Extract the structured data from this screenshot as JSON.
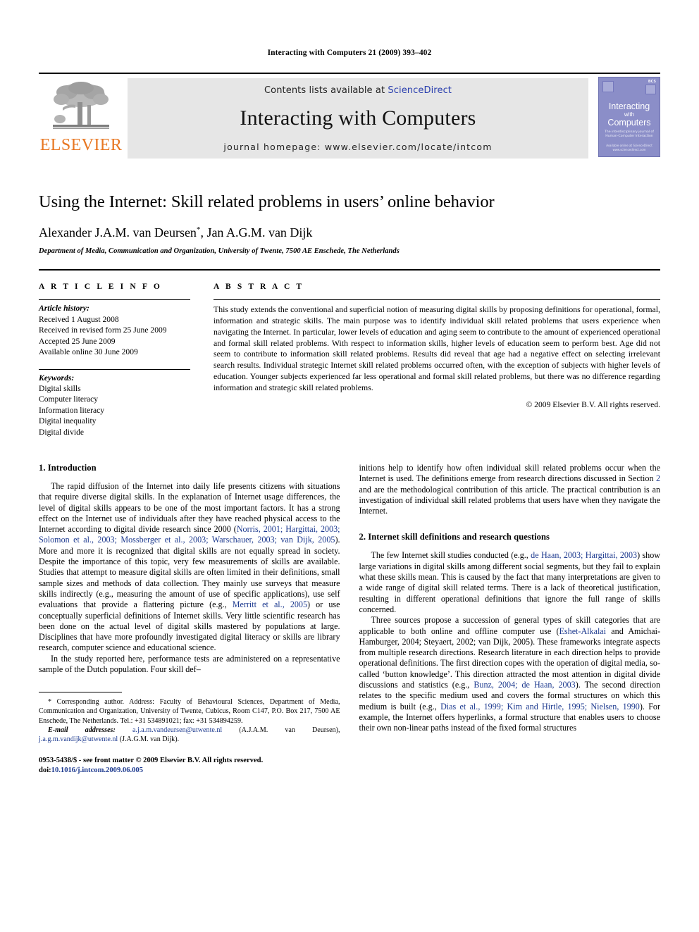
{
  "running_head": "Interacting with Computers 21 (2009) 393–402",
  "masthead": {
    "publisher_name": "ELSEVIER",
    "contents_prefix": "Contents lists available at ",
    "contents_link": "ScienceDirect",
    "journal_title": "Interacting with Computers",
    "homepage_line": "journal homepage: www.elsevier.com/locate/intcom",
    "cover": {
      "title_line1": "Interacting",
      "title_line2": "with",
      "title_line3": "Computers",
      "subtitle": "The interdisciplinary journal of Human-Computer Interaction",
      "badge": "BCS",
      "footer": "Available online at ScienceDirect www.sciencedirect.com"
    },
    "colors": {
      "elsevier_orange": "#E87722",
      "banner_gray": "#e6e6e6",
      "cover_purple": "#8b8ec8",
      "link_blue": "#2a3fae"
    }
  },
  "title": "Using the Internet: Skill related problems in users’ online behavior",
  "authors": "Alexander J.A.M. van Deursen",
  "authors_marker": "*",
  "authors_rest": ", Jan A.G.M. van Dijk",
  "affiliation": "Department of Media, Communication and Organization, University of Twente, 7500 AE Enschede, The Netherlands",
  "article_info": {
    "heading": "A R T I C L E   I N F O",
    "history_label": "Article history:",
    "history": [
      "Received 1 August 2008",
      "Received in revised form 25 June 2009",
      "Accepted 25 June 2009",
      "Available online 30 June 2009"
    ],
    "keywords_label": "Keywords:",
    "keywords": [
      "Digital skills",
      "Computer literacy",
      "Information literacy",
      "Digital inequality",
      "Digital divide"
    ]
  },
  "abstract": {
    "heading": "A B S T R A C T",
    "text": "This study extends the conventional and superficial notion of measuring digital skills by proposing definitions for operational, formal, information and strategic skills. The main purpose was to identify individual skill related problems that users experience when navigating the Internet. In particular, lower levels of education and aging seem to contribute to the amount of experienced operational and formal skill related problems. With respect to information skills, higher levels of education seem to perform best. Age did not seem to contribute to information skill related problems. Results did reveal that age had a negative effect on selecting irrelevant search results. Individual strategic Internet skill related problems occurred often, with the exception of subjects with higher levels of education. Younger subjects experienced far less operational and formal skill related problems, but there was no difference regarding information and strategic skill related problems.",
    "copyright": "© 2009 Elsevier B.V. All rights reserved."
  },
  "sections": {
    "intro_heading": "1. Introduction",
    "intro_p1_a": "The rapid diffusion of the Internet into daily life presents citizens with situations that require diverse digital skills. In the explanation of Internet usage differences, the level of digital skills appears to be one of the most important factors. It has a strong effect on the Internet use of individuals after they have reached physical access to the Internet according to digital divide research since 2000 (",
    "intro_p1_cite1": "Norris, 2001; Hargittai, 2003; Solomon et al., 2003; Mossberger et al., 2003; Warschauer, 2003; van Dijk, 2005",
    "intro_p1_b": "). More and more it is recognized that digital skills are not equally spread in society. Despite the importance of this topic, very few measurements of skills are available. Studies that attempt to measure digital skills are often limited in their definitions, small sample sizes and methods of data collection. They mainly use surveys that measure skills indirectly (e.g., measuring the amount of use of specific applications), use self evaluations that provide a flattering picture (e.g., ",
    "intro_p1_cite2": "Merritt et al., 2005",
    "intro_p1_c": ") or use conceptually superficial definitions of Internet skills. Very little scientific research has been done on the actual level of digital skills mastered by populations at large. Disciplines that have more profoundly investigated digital literacy or skills are library research, computer science and educational science.",
    "intro_p2": "In the study reported here, performance tests are administered on a representative sample of the Dutch population. Four skill def–",
    "col2_p1_a": "initions help to identify how often individual skill related problems occur when the Internet is used. The definitions emerge from research directions discussed in Section ",
    "col2_p1_cite": "2",
    "col2_p1_b": " and are the methodological contribution of this article. The practical contribution is an investigation of individual skill related problems that users have when they navigate the Internet.",
    "sec2_heading": "2. Internet skill definitions and research questions",
    "sec2_p1_a": "The few Internet skill studies conducted (e.g., ",
    "sec2_p1_cite": "de Haan, 2003; Hargittai, 2003",
    "sec2_p1_b": ") show large variations in digital skills among different social segments, but they fail to explain what these skills mean. This is caused by the fact that many interpretations are given to a wide range of digital skill related terms. There is a lack of theoretical justification, resulting in different operational definitions that ignore the full range of skills concerned.",
    "sec2_p2_a": "Three sources propose a succession of general types of skill categories that are applicable to both online and offline computer use (",
    "sec2_p2_cite1": "Eshet-Alkalai",
    "sec2_p2_b": " and Amichai-Hamburger, 2004; Steyaert, 2002; van Dijk, 2005). These frameworks integrate aspects from multiple research directions. Research literature in each direction helps to provide operational definitions. The first direction copes with the operation of digital media, so-called ‘button knowledge’. This direction attracted the most attention in digital divide discussions and statistics (e.g., ",
    "sec2_p2_cite2": "Bunz, 2004; de Haan, 2003",
    "sec2_p2_c": "). The second direction relates to the specific medium used and covers the formal structures on which this medium is built (e.g., ",
    "sec2_p2_cite3": "Dias et al., 1999; Kim and Hirtle, 1995; Nielsen, 1990",
    "sec2_p2_d": "). For example, the Internet offers hyperlinks, a formal structure that enables users to choose their own non-linear paths instead of the fixed formal structures"
  },
  "footnotes": {
    "corresponding_marker": "*",
    "corresponding": "Corresponding author. Address: Faculty of Behavioural Sciences, Department of Media, Communication and Organization, University of Twente, Cubicus, Room C147, P.O. Box 217, 7500 AE Enschede, The Netherlands. Tel.: +31 534891021; fax: +31 534894259.",
    "email_label": "E-mail addresses:",
    "email1": "a.j.a.m.vandeursen@utwente.nl",
    "email1_name": " (A.J.A.M. van Deursen), ",
    "email2": "j.a.g.m.vandijk@utwente.nl",
    "email2_name": " (J.A.G.M. van Dijk).",
    "issn_line": "0953-5438/$ - see front matter © 2009 Elsevier B.V. All rights reserved.",
    "doi_label": "doi:",
    "doi_value": "10.1016/j.intcom.2009.06.005"
  }
}
